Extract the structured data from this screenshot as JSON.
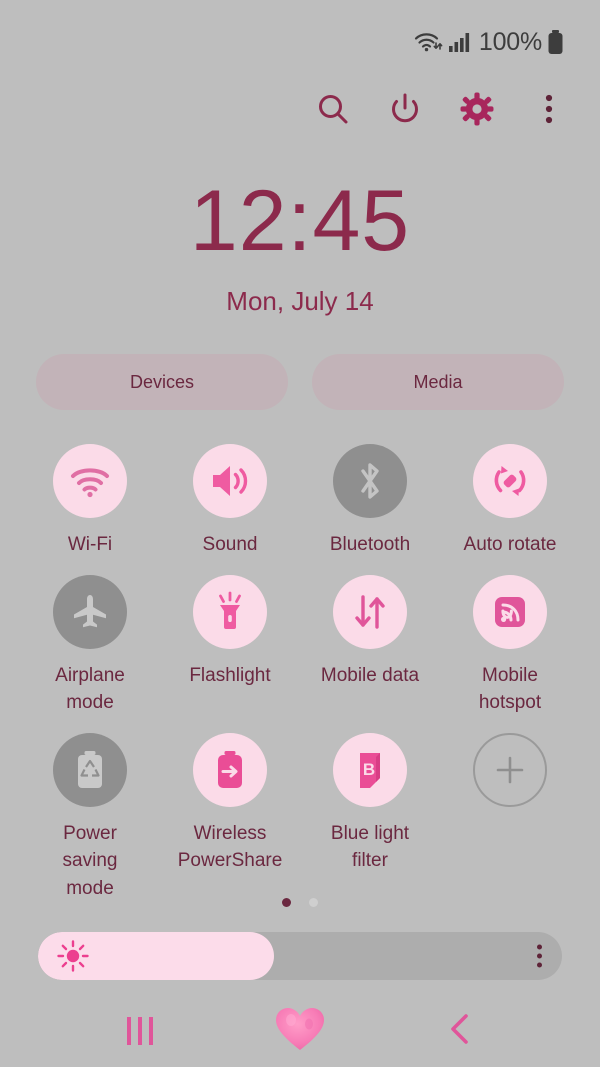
{
  "status_bar": {
    "wifi_icon": "wifi-transfer-icon",
    "signal_icon": "cellular-signal-icon",
    "battery_percent": "100%",
    "battery_icon": "battery-full-icon"
  },
  "header": {
    "buttons": [
      {
        "name": "search-icon",
        "label": "Search"
      },
      {
        "name": "power-icon",
        "label": "Power"
      },
      {
        "name": "settings-gear-icon",
        "label": "Settings"
      },
      {
        "name": "overflow-menu-icon",
        "label": "More options"
      }
    ]
  },
  "clock": {
    "time": "12:45",
    "date": "Mon, July 14"
  },
  "shortcuts": {
    "devices_label": "Devices",
    "media_label": "Media"
  },
  "tiles": [
    {
      "label": "Wi-Fi",
      "icon": "wifi-icon",
      "state": "on"
    },
    {
      "label": "Sound",
      "icon": "sound-icon",
      "state": "on"
    },
    {
      "label": "Bluetooth",
      "icon": "bluetooth-icon",
      "state": "off"
    },
    {
      "label": "Auto rotate",
      "icon": "auto-rotate-icon",
      "state": "on"
    },
    {
      "label": "Airplane mode",
      "icon": "airplane-icon",
      "state": "off"
    },
    {
      "label": "Flashlight",
      "icon": "flashlight-icon",
      "state": "on"
    },
    {
      "label": "Mobile data",
      "icon": "mobile-data-icon",
      "state": "on"
    },
    {
      "label": "Mobile hotspot",
      "icon": "mobile-hotspot-icon",
      "state": "on"
    },
    {
      "label": "Power saving mode",
      "icon": "power-saving-icon",
      "state": "off"
    },
    {
      "label": "Wireless PowerShare",
      "icon": "wireless-powershare-icon",
      "state": "on"
    },
    {
      "label": "Blue light filter",
      "icon": "blue-light-filter-icon",
      "state": "on"
    },
    {
      "label": "",
      "icon": "add-tile-icon",
      "state": "add"
    }
  ],
  "pagination": {
    "pages": 2,
    "active_page": 1
  },
  "brightness": {
    "icon": "brightness-sun-icon",
    "value_percent": 45,
    "menu_icon": "brightness-options-icon"
  },
  "nav_bar": {
    "recents_label": "Recents",
    "home_icon": "heart-home-icon",
    "back_icon": "back-chevron-icon"
  },
  "colors": {
    "background": "#bebebe",
    "accent_pink": "#ec4899",
    "tile_on_bg": "#fbdbe8",
    "tile_off_bg": "#8f8f8f",
    "label_maroon": "#6b2840",
    "clock_maroon": "#8c2a4c"
  }
}
